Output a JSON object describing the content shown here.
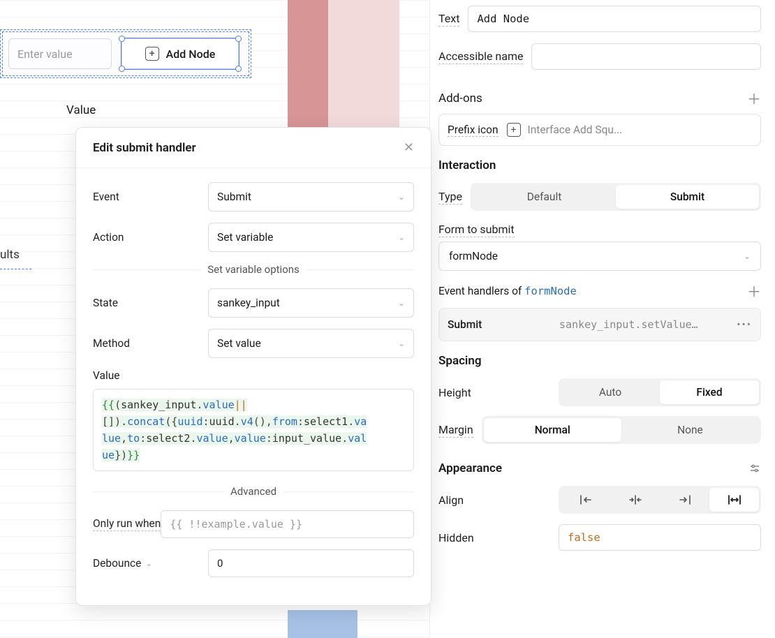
{
  "canvas": {
    "input_placeholder": "Enter value",
    "add_node_label": "Add Node",
    "value_label": "Value",
    "results_label": "ults"
  },
  "modal": {
    "title": "Edit submit handler",
    "event_label": "Event",
    "event_value": "Submit",
    "action_label": "Action",
    "action_value": "Set variable",
    "options_header": "Set variable options",
    "state_label": "State",
    "state_value": "sankey_input",
    "method_label": "Method",
    "method_value": "Set value",
    "value_label": "Value",
    "value_code": "{{(sankey_input.value||[]).concat({uuid:uuid.v4(),from:select1.value,to:select2.value,value:input_value.value})}}",
    "advanced_header": "Advanced",
    "only_run_label": "Only run when",
    "only_run_placeholder": "{{ !!example.value }}",
    "debounce_label": "Debounce",
    "debounce_value": "0"
  },
  "inspector": {
    "text_label": "Text",
    "text_value": "Add Node",
    "accessible_label": "Accessible name",
    "accessible_value": "",
    "addons_header": "Add-ons",
    "prefix_label": "Prefix icon",
    "prefix_value": "Interface Add Squ...",
    "interaction_header": "Interaction",
    "type_label": "Type",
    "type_options": [
      "Default",
      "Submit"
    ],
    "type_active": "Submit",
    "form_label": "Form to submit",
    "form_value": "formNode",
    "handlers_label_prefix": "Event handlers of ",
    "handlers_target": "formNode",
    "handler_name": "Submit",
    "handler_desc": "sankey_input.setValue…",
    "spacing_header": "Spacing",
    "height_label": "Height",
    "height_options": [
      "Auto",
      "Fixed"
    ],
    "height_active": "Fixed",
    "margin_label": "Margin",
    "margin_options": [
      "Normal",
      "None"
    ],
    "margin_active": "Normal",
    "appearance_header": "Appearance",
    "align_label": "Align",
    "hidden_label": "Hidden",
    "hidden_value": "false"
  }
}
